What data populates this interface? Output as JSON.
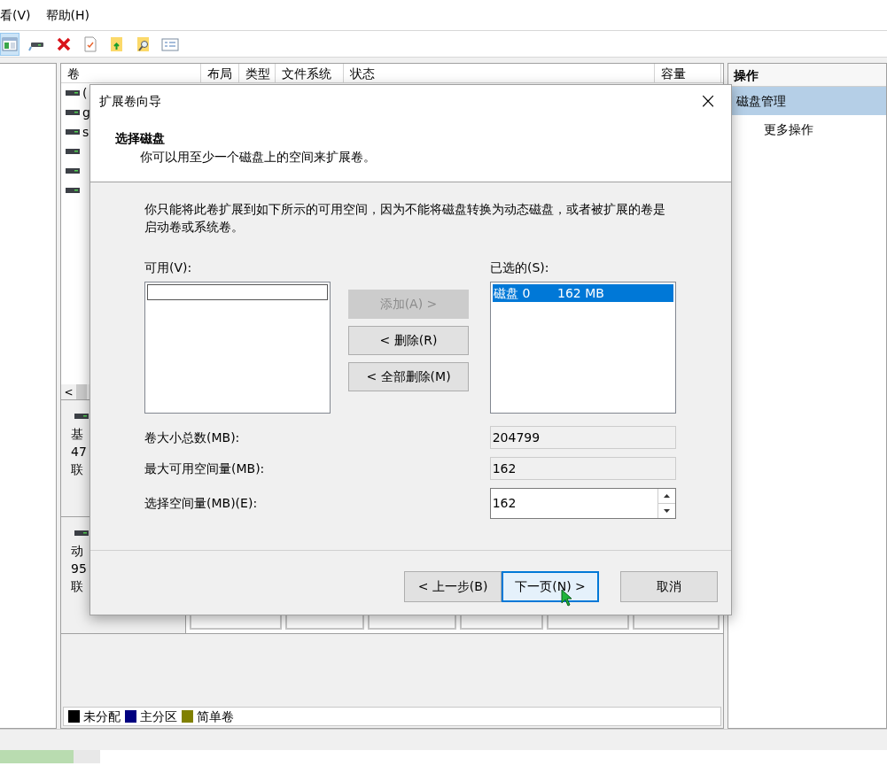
{
  "menu": [
    {
      "label": "看(V)"
    },
    {
      "label": "帮助(H)"
    }
  ],
  "volume_table": {
    "columns": [
      "卷",
      "布局",
      "类型",
      "文件系统",
      "状态",
      "容量"
    ],
    "rows": [
      {
        "label": "("
      },
      {
        "label": "g"
      },
      {
        "label": "s"
      },
      {},
      {},
      {}
    ],
    "scroll_left": "<"
  },
  "disks": [
    {
      "lines": [
        "基",
        "47",
        "联"
      ]
    },
    {
      "lines": [
        "动",
        "95",
        "联"
      ]
    }
  ],
  "legend": [
    {
      "label": "未分配",
      "color": "#000000"
    },
    {
      "label": "主分区",
      "color": "#000080"
    },
    {
      "label": "简单卷",
      "color": "#808000"
    }
  ],
  "actions": {
    "title": "操作",
    "items": [
      {
        "label": "磁盘管理",
        "selected": true,
        "kind": "group"
      },
      {
        "label": "更多操作",
        "selected": false,
        "kind": "item"
      }
    ]
  },
  "dialog": {
    "title": "扩展卷向导",
    "close": "×",
    "heading": "选择磁盘",
    "subheading": "你可以用至少一个磁盘上的空间来扩展卷。",
    "description": "你只能将此卷扩展到如下所示的可用空间，因为不能将磁盘转换为动态磁盘，或者被扩展的卷是启动卷或系统卷。",
    "available": {
      "label": "可用(V):"
    },
    "selected_list": {
      "label": "已选的(S):",
      "items": [
        {
          "disk": "磁盘 0",
          "size": "162 MB",
          "selected": true
        }
      ]
    },
    "move_buttons": [
      {
        "label": "添加(A) >",
        "disabled": true
      },
      {
        "label": "< 删除(R)",
        "disabled": false
      },
      {
        "label": "< 全部删除(M)",
        "disabled": false
      }
    ],
    "fields": [
      {
        "label": "卷大小总数(MB):",
        "value": "204799",
        "kind": "readonly"
      },
      {
        "label": "最大可用空间量(MB):",
        "value": "162",
        "kind": "readonly"
      },
      {
        "label": "选择空间量(MB)(E):",
        "value": "162",
        "kind": "spinner"
      }
    ],
    "footer_buttons": [
      {
        "label": "< 上一步(B)",
        "focused": false
      },
      {
        "label": "下一页(N) >",
        "focused": true
      },
      {
        "label": "取消",
        "focused": false
      }
    ]
  }
}
